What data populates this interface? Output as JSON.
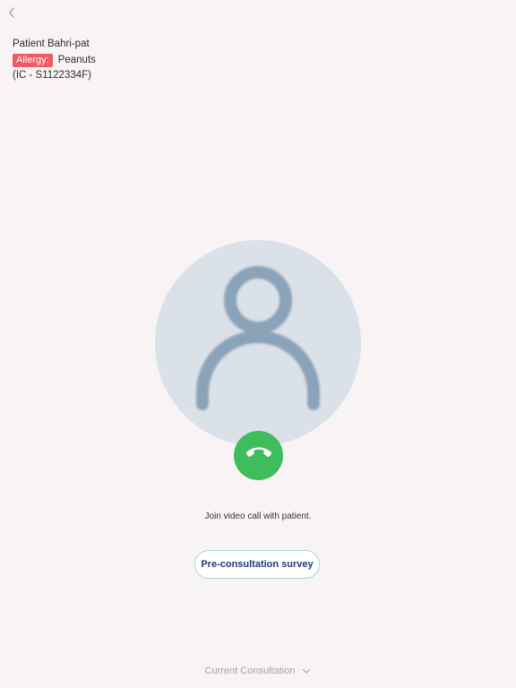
{
  "nav": {
    "back_icon": "chevron-left-icon"
  },
  "patient": {
    "name": "Patient Bahri-pat",
    "allergy_label": "Allergy:",
    "allergy_value": "Peanuts",
    "ic": "(IC - S1122334F)"
  },
  "call": {
    "avatar_icon": "person-icon",
    "call_icon": "phone-icon",
    "join_text": "Join video call with patient."
  },
  "actions": {
    "survey_label": "Pre-consultation survey"
  },
  "footer": {
    "label": "Current Consultation",
    "chevron_icon": "chevron-down-icon"
  },
  "colors": {
    "background": "#f8f4f6",
    "allergy_badge": "#ee5a5f",
    "avatar_bg": "#dbe1e8",
    "avatar_figure": "#8aa3b8",
    "call_button": "#3fbc5c",
    "survey_border": "#a5d8d3",
    "survey_text": "#1d3d7a"
  }
}
